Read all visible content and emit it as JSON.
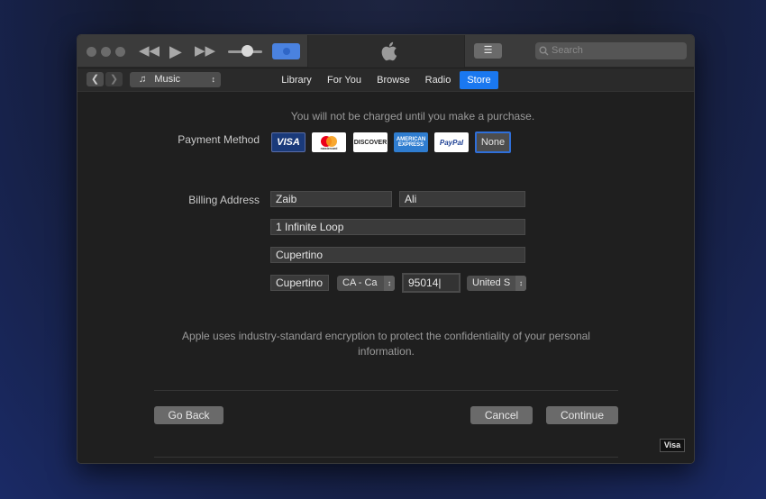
{
  "toolbar": {
    "search_placeholder": "Search"
  },
  "nav": {
    "media_kind": "Music",
    "tabs": [
      {
        "label": "Library"
      },
      {
        "label": "For You"
      },
      {
        "label": "Browse"
      },
      {
        "label": "Radio"
      },
      {
        "label": "Store",
        "active": true
      }
    ]
  },
  "form": {
    "notice": "You will not be charged until you make a purchase.",
    "payment_label": "Payment Method",
    "cards": [
      {
        "name": "visa",
        "text": "VISA"
      },
      {
        "name": "mastercard",
        "text": "mastercard"
      },
      {
        "name": "discover",
        "text": "DISCOVER"
      },
      {
        "name": "amex",
        "text": "AMERICAN EXPRESS"
      },
      {
        "name": "paypal",
        "text": "PayPal"
      },
      {
        "name": "none",
        "text": "None",
        "selected": true
      }
    ],
    "billing_label": "Billing Address",
    "first_name": "Zaib",
    "last_name": "Ali",
    "street": "1 Infinite Loop",
    "city_line": "Cupertino",
    "city": "Cupertino",
    "state": "CA - Ca",
    "zip": "95014",
    "country": "United S",
    "privacy": "Apple uses industry-standard encryption to protect the confidentiality of your personal information."
  },
  "buttons": {
    "back": "Go Back",
    "cancel": "Cancel",
    "continue": "Continue"
  },
  "badge": "Visa",
  "colors": {
    "accent": "#1a78f0",
    "selection_border": "#2f6fd9"
  }
}
